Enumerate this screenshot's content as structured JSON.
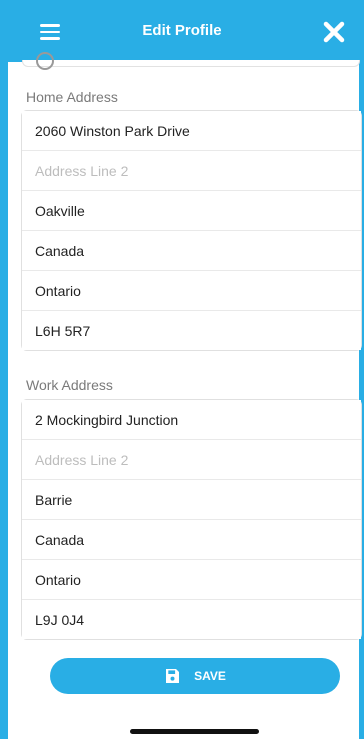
{
  "header": {
    "title": "Edit Profile",
    "menu_icon": "menu-icon",
    "close_icon": "close-icon"
  },
  "home_address": {
    "label": "Home Address",
    "line1": "2060 Winston Park Drive",
    "line2_placeholder": "Address Line 2",
    "city": "Oakville",
    "country": "Canada",
    "province": "Ontario",
    "postal_code": "L6H 5R7"
  },
  "work_address": {
    "label": "Work Address",
    "line1": "2 Mockingbird Junction",
    "line2_placeholder": "Address Line 2",
    "city": "Barrie",
    "country": "Canada",
    "province": "Ontario",
    "postal_code": "L9J 0J4"
  },
  "actions": {
    "save_label": "SAVE",
    "save_icon": "floppy-disk-icon"
  },
  "colors": {
    "accent": "#29AEE5",
    "header_text": "#FFFFFF"
  }
}
